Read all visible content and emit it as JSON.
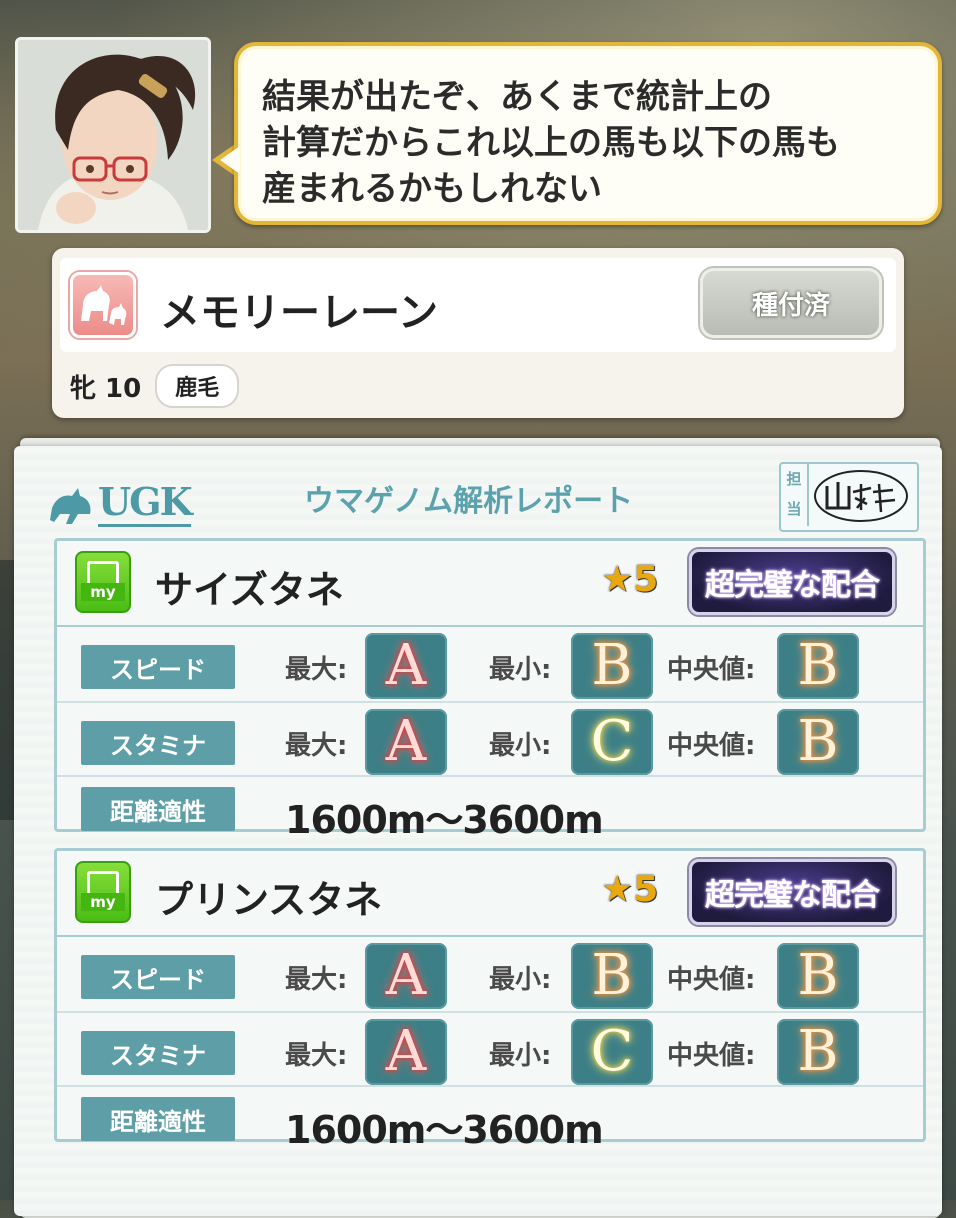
{
  "dialogue": {
    "lines": [
      "結果が出たぞ、あくまで統計上の",
      "計算だからこれ以上の馬も以下の馬も",
      "産まれるかもしれない"
    ]
  },
  "horse": {
    "name": "メモリーレーン",
    "status_button": "種付済",
    "sex_age": "牝 10",
    "coat": "鹿毛",
    "icon": "horse-icon"
  },
  "report": {
    "logo": "UGK",
    "title": "ウマゲノム解析レポート",
    "staff_label": "担当",
    "staff_signature": "山科",
    "panels": [
      {
        "icon": "my-icon",
        "icon_text": "my",
        "name": "サイズタネ",
        "stars": "5",
        "badge": "超完璧な配合",
        "rows": [
          {
            "label": "スピード",
            "max_label": "最大:",
            "max": "A",
            "min_label": "最小:",
            "min": "B",
            "median_label": "中央値:",
            "median": "B"
          },
          {
            "label": "スタミナ",
            "max_label": "最大:",
            "max": "A",
            "min_label": "最小:",
            "min": "C",
            "median_label": "中央値:",
            "median": "B"
          }
        ],
        "distance_label": "距離適性",
        "distance": "1600m〜3600m"
      },
      {
        "icon": "my-icon",
        "icon_text": "my",
        "name": "プリンスタネ",
        "stars": "5",
        "badge": "超完璧な配合",
        "rows": [
          {
            "label": "スピード",
            "max_label": "最大:",
            "max": "A",
            "min_label": "最小:",
            "min": "B",
            "median_label": "中央値:",
            "median": "B"
          },
          {
            "label": "スタミナ",
            "max_label": "最大:",
            "max": "A",
            "min_label": "最小:",
            "min": "C",
            "median_label": "中央値:",
            "median": "B"
          }
        ],
        "distance_label": "距離適性",
        "distance": "1600m〜3600m"
      }
    ]
  }
}
